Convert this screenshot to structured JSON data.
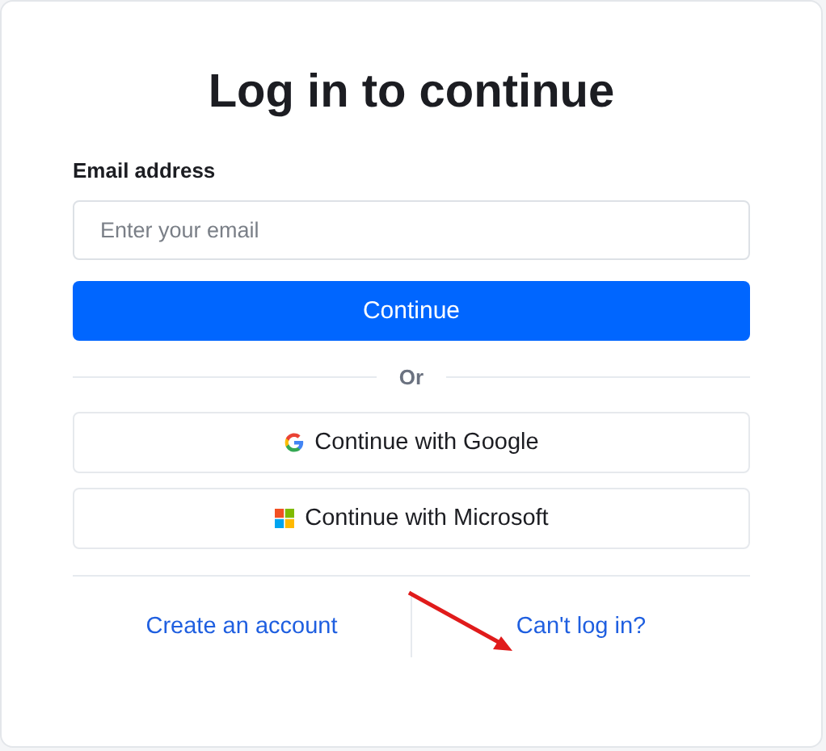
{
  "title": "Log in to continue",
  "email": {
    "label": "Email address",
    "placeholder": "Enter your email"
  },
  "primary_button": "Continue",
  "divider": "Or",
  "social_buttons": [
    {
      "kind": "google",
      "label": "Continue with Google"
    },
    {
      "kind": "microsoft",
      "label": "Continue with Microsoft"
    }
  ],
  "footer_links": [
    "Create an account",
    "Can't log in?"
  ]
}
